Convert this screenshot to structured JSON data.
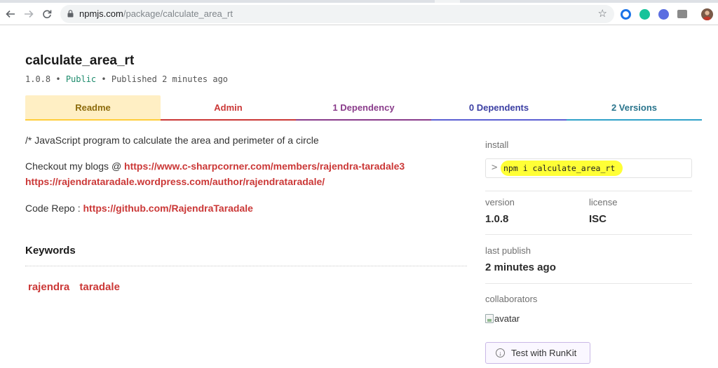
{
  "browser": {
    "url_domain": "npmjs.com",
    "url_path": "/package/calculate_area_rt",
    "back_icon": "arrow-left-icon",
    "forward_icon": "arrow-right-icon",
    "reload_icon": "reload-icon",
    "star_icon": "bookmark-star-icon",
    "extensions": [
      {
        "name": "circle-ring-extension-icon",
        "color": "#1a73e8"
      },
      {
        "name": "grammarly-extension-icon",
        "color": "#15c39a"
      },
      {
        "name": "check-circle-extension-icon",
        "color": "#5b6ee1"
      },
      {
        "name": "camera-extension-icon",
        "color": "#8a8a8a"
      }
    ]
  },
  "package": {
    "name": "calculate_area_rt",
    "version_line": {
      "version": "1.0.8",
      "sep1": " • ",
      "visibility": "Public",
      "sep2": " • ",
      "published": "Published 2 minutes ago"
    }
  },
  "tabs": [
    {
      "id": "readme",
      "label": "Readme"
    },
    {
      "id": "admin",
      "label": "Admin"
    },
    {
      "id": "deps",
      "label": "1  Dependency"
    },
    {
      "id": "dependents",
      "label": "0  Dependents"
    },
    {
      "id": "versions",
      "label": "2  Versions"
    }
  ],
  "readme": {
    "line1": "/* JavaScript program to calculate the area and perimeter of a circle",
    "blogs_prefix": "Checkout my blogs @ ",
    "blog_link1": "https://www.c-sharpcorner.com/members/rajendra-taradale3",
    "blog_link2": "https://rajendrataradale.wordpress.com/author/rajendrataradale/",
    "repo_prefix": "Code Repo : ",
    "repo_link": "https://github.com/RajendraTaradale"
  },
  "keywords": {
    "heading": "Keywords",
    "items": [
      "rajendra",
      "taradale"
    ]
  },
  "sidebar": {
    "install_label": "install",
    "install_cmd": "npm i calculate_area_rt",
    "version_label": "version",
    "version_value": "1.0.8",
    "license_label": "license",
    "license_value": "ISC",
    "last_publish_label": "last publish",
    "last_publish_value": "2 minutes ago",
    "collaborators_label": "collaborators",
    "avatar_alt": "avatar",
    "runkit_label": "Test with RunKit"
  },
  "colors": {
    "npm_red": "#cb3837",
    "highlight": "#ffff36"
  }
}
